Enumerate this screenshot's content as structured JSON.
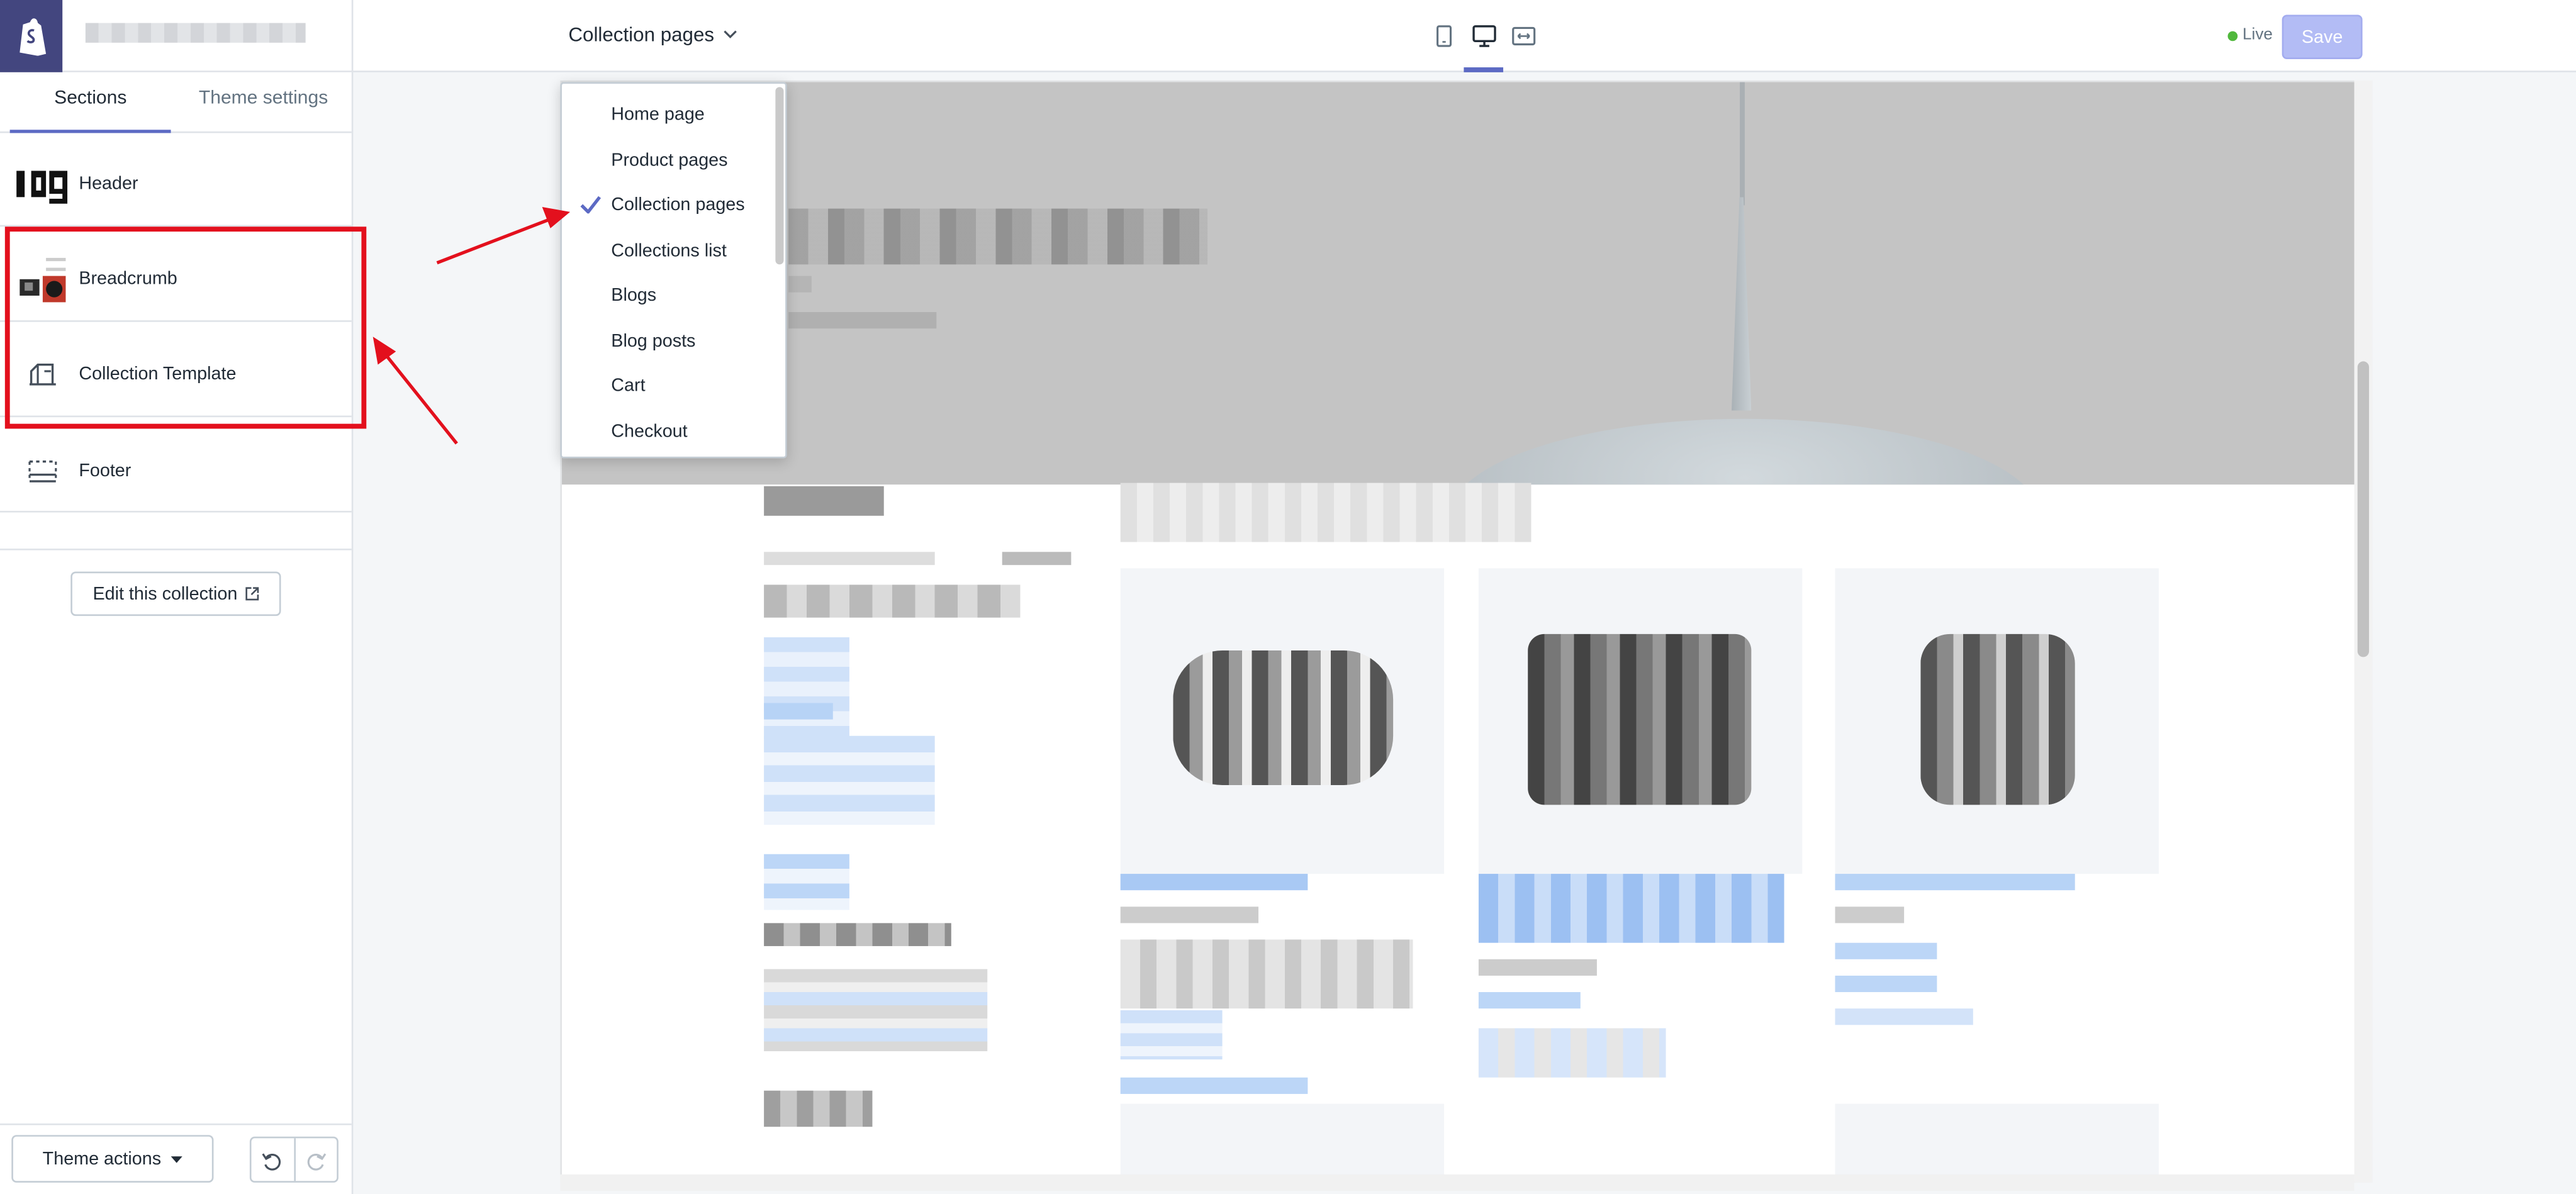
{
  "topbar": {
    "page_selector": "Collection pages",
    "live_label": "Live",
    "save_label": "Save"
  },
  "sidebar": {
    "tabs": [
      {
        "label": "Sections"
      },
      {
        "label": "Theme settings"
      }
    ],
    "sections": [
      {
        "label": "Header"
      },
      {
        "label": "Breadcrumb"
      },
      {
        "label": "Collection Template"
      },
      {
        "label": "Footer"
      }
    ],
    "edit_collection_label": "Edit this collection",
    "theme_actions_label": "Theme actions"
  },
  "dropdown": {
    "items": [
      {
        "label": "Home page"
      },
      {
        "label": "Product pages"
      },
      {
        "label": "Collection pages",
        "selected": true
      },
      {
        "label": "Collections list"
      },
      {
        "label": "Blogs"
      },
      {
        "label": "Blog posts"
      },
      {
        "label": "Cart"
      },
      {
        "label": "Checkout"
      }
    ]
  },
  "colors": {
    "accent": "#5c6ac4",
    "logo_bg": "#43467f",
    "save_disabled": "#b3bcf5",
    "annotation_red": "#e3101d",
    "live_dot": "#50b83c"
  },
  "icons": [
    "shopify-logo-icon",
    "chevron-down-icon",
    "mobile-icon",
    "desktop-icon",
    "fullwidth-icon",
    "external-link-icon",
    "undo-icon",
    "redo-icon",
    "checkmark-icon",
    "collection-icon",
    "footer-icon"
  ]
}
